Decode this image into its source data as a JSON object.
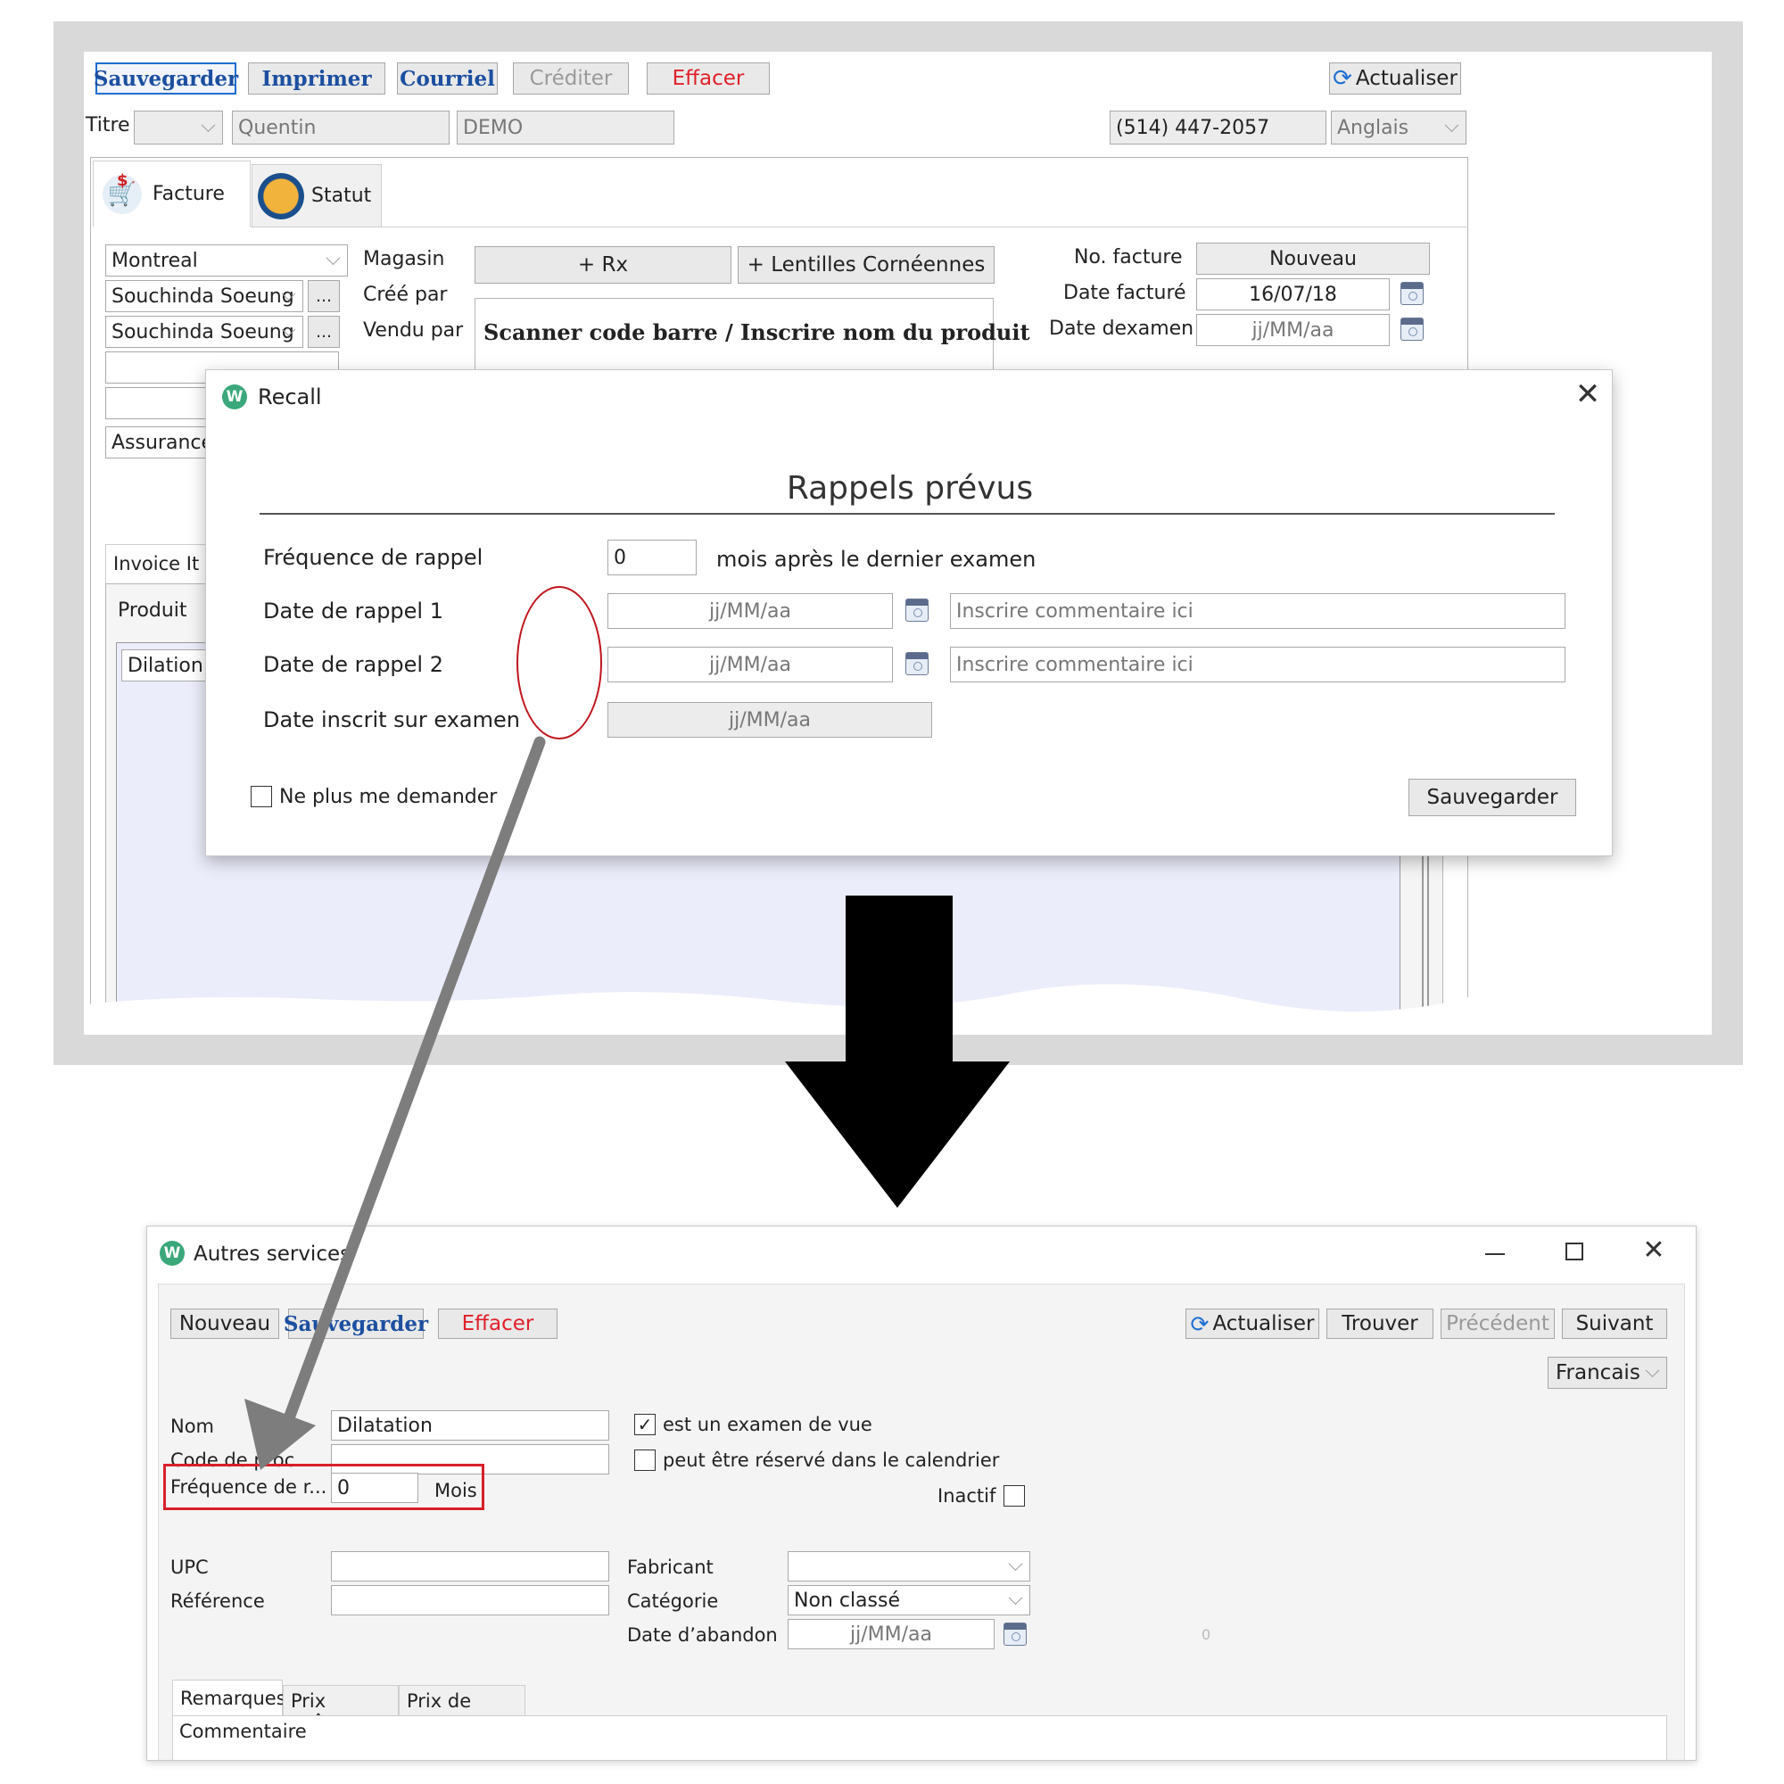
{
  "top": {
    "toolbar": {
      "save": "Sauvegarder",
      "print": "Imprimer",
      "email": "Courriel",
      "credit": "Créditer",
      "erase": "Effacer",
      "refresh": "Actualiser"
    },
    "patient": {
      "title_label": "Titre",
      "first_name": "Quentin",
      "last_name": "DEMO",
      "phone": "(514) 447-2057",
      "language": "Anglais"
    },
    "tabs": {
      "invoice": "Facture",
      "status": "Statut"
    },
    "form": {
      "store_value": "Montreal",
      "store_label": "Magasin",
      "created_by_value": "Souchinda Soeung",
      "created_by_label": "Créé par",
      "sold_by_value": "Souchinda Soeung",
      "sold_by_label": "Vendu par",
      "insurance_value": "Assurance",
      "rx_button": "+ Rx",
      "contact_button": "+ Lentilles Cornéennes",
      "scanner_label": "Scanner code barre / Inscrire nom du produit",
      "invoice_no_label": "No. facture",
      "invoice_no_value": "Nouveau",
      "invoice_date_label": "Date facturé",
      "invoice_date_value": "16/07/18",
      "exam_date_label": "Date dexamen",
      "exam_date_value": "jj/MM/aa"
    },
    "items": {
      "tab": "Invoice It",
      "product_header": "Produit",
      "product_value": "Dilation"
    }
  },
  "recall": {
    "window_title": "Recall",
    "heading": "Rappels prévus",
    "frequency_label": "Fréquence de rappel",
    "frequency_value": "0",
    "frequency_suffix": "mois après le dernier examen",
    "date1_label": "Date de rappel 1",
    "date1_value": "jj/MM/aa",
    "comment1_placeholder": "Inscrire commentaire ici",
    "date2_label": "Date de rappel 2",
    "date2_value": "jj/MM/aa",
    "comment2_placeholder": "Inscrire commentaire ici",
    "exam_date_label": "Date inscrit sur examen",
    "exam_date_value": "jj/MM/aa",
    "dont_ask_label": "Ne plus me demander",
    "save_button": "Sauvegarder"
  },
  "services": {
    "window_title": "Autres services",
    "toolbar": {
      "new": "Nouveau",
      "save": "Sauvegarder",
      "erase": "Effacer",
      "refresh": "Actualiser",
      "find": "Trouver",
      "previous": "Précédent",
      "next": "Suivant"
    },
    "language": "Francais",
    "name_label": "Nom",
    "name_value": "Dilatation",
    "proc_code_label": "Code de proc...",
    "frequency_label": "Fréquence de r...",
    "frequency_value": "0",
    "frequency_unit": "Mois",
    "eye_exam_label": "est un examen de vue",
    "eye_exam_checked": true,
    "bookable_label": "peut être réservé dans le calendrier",
    "bookable_checked": false,
    "inactive_label": "Inactif",
    "upc_label": "UPC",
    "reference_label": "Référence",
    "manufacturer_label": "Fabricant",
    "category_label": "Catégorie",
    "category_value": "Non classé",
    "abandon_date_label": "Date d’abandon",
    "abandon_date_value": "jj/MM/aa",
    "zero_value": "0",
    "tabs": {
      "remarks": "Remarques",
      "cost_price": "Prix coûtant",
      "sale_price": "Prix de vente"
    },
    "comment_label": "Commentaire"
  },
  "colors": {
    "accent": "#1d6fd1",
    "danger": "#e0202a",
    "highlight_red": "#d8202a",
    "arrow_grey": "#7d7d7d",
    "frame_grey": "#d9d9d9",
    "list_bg": "#ecedfb"
  }
}
